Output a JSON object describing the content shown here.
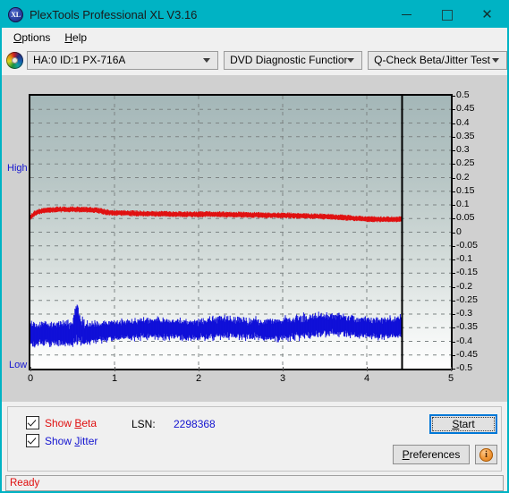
{
  "window": {
    "title": "PlexTools Professional XL V3.16",
    "icon_label": "XL",
    "accent_color": "#00b3c4",
    "buttons": {
      "minimize": "–",
      "maximize": "□",
      "close": "✕"
    }
  },
  "menubar": {
    "items": [
      {
        "label": "Options",
        "mnemonic": "O"
      },
      {
        "label": "Help",
        "mnemonic": "H"
      }
    ]
  },
  "toolbar": {
    "drive_icon": "disc-icon",
    "drive_select": {
      "value": "HA:0 ID:1  PX-716A"
    },
    "function_select": {
      "value": "DVD Diagnostic Functions"
    },
    "test_select": {
      "value": "Q-Check Beta/Jitter Test"
    }
  },
  "chart_labels": {
    "high": "High",
    "low": "Low"
  },
  "controls": {
    "show_beta": {
      "label": "Show Beta",
      "mnemonic": "B",
      "checked": true,
      "color": "#e01010"
    },
    "show_jitter": {
      "label": "Show Jitter",
      "mnemonic": "J",
      "checked": true,
      "color": "#1414d0"
    },
    "lsn_label": "LSN:",
    "lsn_value": "2298368",
    "start_button": "Start",
    "preferences_button": "Preferences",
    "info_button": "i"
  },
  "statusbar": {
    "text": "Ready"
  },
  "chart_data": {
    "type": "line",
    "title": "Q-Check Beta/Jitter Test",
    "xlabel": "",
    "ylabel": "",
    "xlim": [
      0,
      5
    ],
    "ylim": [
      -0.5,
      0.5
    ],
    "xticks": [
      0,
      1,
      2,
      3,
      4,
      5
    ],
    "yticks": [
      0.5,
      0.45,
      0.4,
      0.35,
      0.3,
      0.25,
      0.2,
      0.15,
      0.1,
      0.05,
      0,
      -0.05,
      -0.1,
      -0.15,
      -0.2,
      -0.25,
      -0.3,
      -0.35,
      -0.4,
      -0.45,
      -0.5
    ],
    "grid": true,
    "grid_style": "dashed",
    "legend_position": "bottom-left",
    "data_end_marker_x": 4.42,
    "background_gradient": [
      "#a4b7b8",
      "#ffffff"
    ],
    "series": [
      {
        "name": "Beta",
        "color": "#e01010",
        "axis_side": "right",
        "x": [
          0.0,
          0.05,
          0.1,
          0.15,
          0.2,
          0.25,
          0.3,
          0.4,
          0.5,
          0.6,
          0.7,
          0.8,
          0.9,
          1.0,
          1.1,
          1.2,
          1.3,
          1.4,
          1.5,
          1.6,
          1.7,
          1.8,
          1.9,
          2.0,
          2.1,
          2.2,
          2.3,
          2.4,
          2.5,
          2.6,
          2.7,
          2.8,
          2.9,
          3.0,
          3.1,
          3.2,
          3.3,
          3.4,
          3.5,
          3.6,
          3.7,
          3.8,
          3.9,
          4.0,
          4.1,
          4.2,
          4.3,
          4.42
        ],
        "values": [
          0.055,
          0.068,
          0.075,
          0.079,
          0.081,
          0.082,
          0.083,
          0.083,
          0.084,
          0.083,
          0.082,
          0.08,
          0.073,
          0.071,
          0.07,
          0.069,
          0.068,
          0.068,
          0.067,
          0.067,
          0.066,
          0.066,
          0.065,
          0.065,
          0.066,
          0.066,
          0.065,
          0.064,
          0.064,
          0.063,
          0.063,
          0.062,
          0.062,
          0.061,
          0.061,
          0.06,
          0.059,
          0.058,
          0.057,
          0.056,
          0.054,
          0.052,
          0.05,
          0.048,
          0.047,
          0.047,
          0.047,
          0.047
        ]
      },
      {
        "name": "Jitter",
        "color": "#1010d8",
        "axis_side": "right",
        "band": true,
        "x": [
          0.0,
          0.1,
          0.2,
          0.3,
          0.4,
          0.5,
          0.55,
          0.6,
          0.7,
          0.8,
          0.9,
          1.0,
          1.1,
          1.2,
          1.3,
          1.4,
          1.5,
          1.6,
          1.7,
          1.8,
          1.9,
          2.0,
          2.1,
          2.2,
          2.3,
          2.4,
          2.5,
          2.6,
          2.7,
          2.8,
          2.9,
          3.0,
          3.1,
          3.2,
          3.3,
          3.4,
          3.5,
          3.6,
          3.7,
          3.8,
          3.9,
          4.0,
          4.1,
          4.2,
          4.3,
          4.42
        ],
        "center": [
          -0.378,
          -0.372,
          -0.37,
          -0.372,
          -0.374,
          -0.368,
          -0.33,
          -0.368,
          -0.372,
          -0.365,
          -0.362,
          -0.36,
          -0.358,
          -0.356,
          -0.355,
          -0.352,
          -0.352,
          -0.354,
          -0.356,
          -0.358,
          -0.36,
          -0.358,
          -0.354,
          -0.35,
          -0.348,
          -0.35,
          -0.352,
          -0.354,
          -0.356,
          -0.358,
          -0.358,
          -0.356,
          -0.352,
          -0.348,
          -0.344,
          -0.342,
          -0.34,
          -0.338,
          -0.34,
          -0.344,
          -0.348,
          -0.35,
          -0.352,
          -0.352,
          -0.35,
          -0.345
        ],
        "spread": [
          0.035,
          0.034,
          0.033,
          0.034,
          0.036,
          0.038,
          0.065,
          0.038,
          0.033,
          0.031,
          0.03,
          0.03,
          0.029,
          0.029,
          0.03,
          0.031,
          0.031,
          0.03,
          0.029,
          0.029,
          0.029,
          0.03,
          0.031,
          0.032,
          0.032,
          0.031,
          0.03,
          0.03,
          0.03,
          0.031,
          0.031,
          0.032,
          0.033,
          0.034,
          0.035,
          0.035,
          0.034,
          0.033,
          0.032,
          0.031,
          0.03,
          0.03,
          0.031,
          0.032,
          0.032,
          0.03
        ]
      }
    ]
  }
}
